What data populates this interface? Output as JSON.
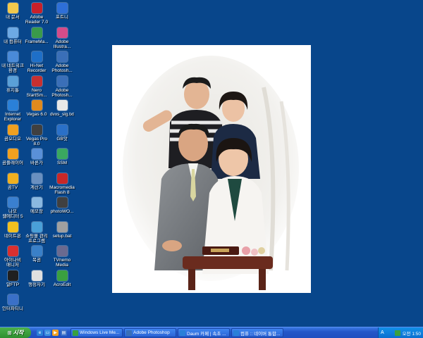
{
  "desktop": {
    "background_color": "#08468b",
    "icons": [
      {
        "label": "내 문서",
        "icon": "folder-icon",
        "color": "#f2c94c"
      },
      {
        "label": "Adobe\nReader 7.0",
        "icon": "pdf-icon",
        "color": "#c8202a"
      },
      {
        "label": "포트니",
        "icon": "globe-icon",
        "color": "#2e6fd8"
      },
      {
        "label": "내 컴퓨터",
        "icon": "computer-icon",
        "color": "#6da9e4"
      },
      {
        "label": "FrameMa...",
        "icon": "frame-icon",
        "color": "#3a9a4a"
      },
      {
        "label": "Adobe\nIllustra...",
        "icon": "flower-icon",
        "color": "#d44c8a"
      },
      {
        "label": "내 네트워크\n환경",
        "icon": "network-icon",
        "color": "#4a8ad8"
      },
      {
        "label": "Hi-Net\nRecorder",
        "icon": "hi-icon",
        "color": "#1e6fc8"
      },
      {
        "label": "Adobe\nPhotosh...",
        "icon": "photoshop-icon",
        "color": "#3a6fb8"
      },
      {
        "label": "휴지통",
        "icon": "trash-icon",
        "color": "#5aa0d8"
      },
      {
        "label": "Nero\nStartSm...",
        "icon": "nero-icon",
        "color": "#c83030"
      },
      {
        "label": "Adobe\nPhotosh...",
        "icon": "photoshop-icon",
        "color": "#3a6fb8"
      },
      {
        "label": "Internet\nExplorer",
        "icon": "ie-icon",
        "color": "#2a80d8"
      },
      {
        "label": "Vegas 6.0",
        "icon": "vegas-icon",
        "color": "#e08a1e"
      },
      {
        "label": "dvxs_slg.txt",
        "icon": "text-file-icon",
        "color": "#e8e8e8"
      },
      {
        "label": "곰오디오",
        "icon": "gom-audio-icon",
        "color": "#f0a020"
      },
      {
        "label": "Vegas Pro\n8.0",
        "icon": "vegas-pro-icon",
        "color": "#404040"
      },
      {
        "label": "GB앗",
        "icon": "gb-icon",
        "color": "#2a70c8"
      },
      {
        "label": "곰플레이어",
        "icon": "gom-player-icon",
        "color": "#f0a020"
      },
      {
        "label": "바론가",
        "icon": "document-icon",
        "color": "#5a90d8"
      },
      {
        "label": "SSM",
        "icon": "ssm-icon",
        "color": "#3aa860"
      },
      {
        "label": "곰TV",
        "icon": "gom-tv-icon",
        "color": "#f0b020"
      },
      {
        "label": "계산기",
        "icon": "calculator-icon",
        "color": "#6a90c0"
      },
      {
        "label": "Macromedia\nFlash 8",
        "icon": "flash-icon",
        "color": "#c82828"
      },
      {
        "label": "나모\n웹에디터 5",
        "icon": "namo-icon",
        "color": "#3a80d0"
      },
      {
        "label": "메모장",
        "icon": "notepad-icon",
        "color": "#8ab8e0"
      },
      {
        "label": "photoWO...",
        "icon": "photo-icon",
        "color": "#404040"
      },
      {
        "label": "네이트온",
        "icon": "nateon-icon",
        "color": "#f0c020"
      },
      {
        "label": "쇼핑몰 관리\n프로그램",
        "icon": "shop-icon",
        "color": "#4aa0d8"
      },
      {
        "label": "setup.bat",
        "icon": "batch-file-icon",
        "color": "#a0a0a0"
      },
      {
        "label": "아이나비\n매니저",
        "icon": "inavi-icon",
        "color": "#d83030"
      },
      {
        "label": "복권",
        "icon": "lottery-icon",
        "color": "#3a80c8"
      },
      {
        "label": "TVnemo\nMedia",
        "icon": "tv-icon",
        "color": "#6a6a90"
      },
      {
        "label": "알FTP",
        "icon": "ftp-icon",
        "color": "#202020"
      },
      {
        "label": "행정자기",
        "icon": "usb-icon",
        "color": "#e0e0e0"
      },
      {
        "label": "AcroEdit",
        "icon": "acroedit-icon",
        "color": "#3aa040"
      },
      {
        "label": "인터파티니",
        "icon": "interparty-icon",
        "color": "#3a70c8"
      }
    ]
  },
  "photo": {
    "description_icon": "family-photo-image",
    "background_color": "#ffffff"
  },
  "taskbar": {
    "start_label": "시작",
    "tasks": [
      {
        "label": "Windows Live Me...",
        "icon": "messenger-icon",
        "color": "#3aa040"
      },
      {
        "label": "Adobe Photoshop",
        "icon": "photoshop-icon",
        "color": "#3a6fb8"
      },
      {
        "label": "Daum 카페 | 속초 ...",
        "icon": "ie-icon",
        "color": "#2a80d8"
      },
      {
        "label": "컴퓨 :: 네이버 통합...",
        "icon": "ie-icon",
        "color": "#2a80d8"
      }
    ],
    "tray": {
      "ime": "A",
      "clock": "오전 1:50"
    }
  }
}
